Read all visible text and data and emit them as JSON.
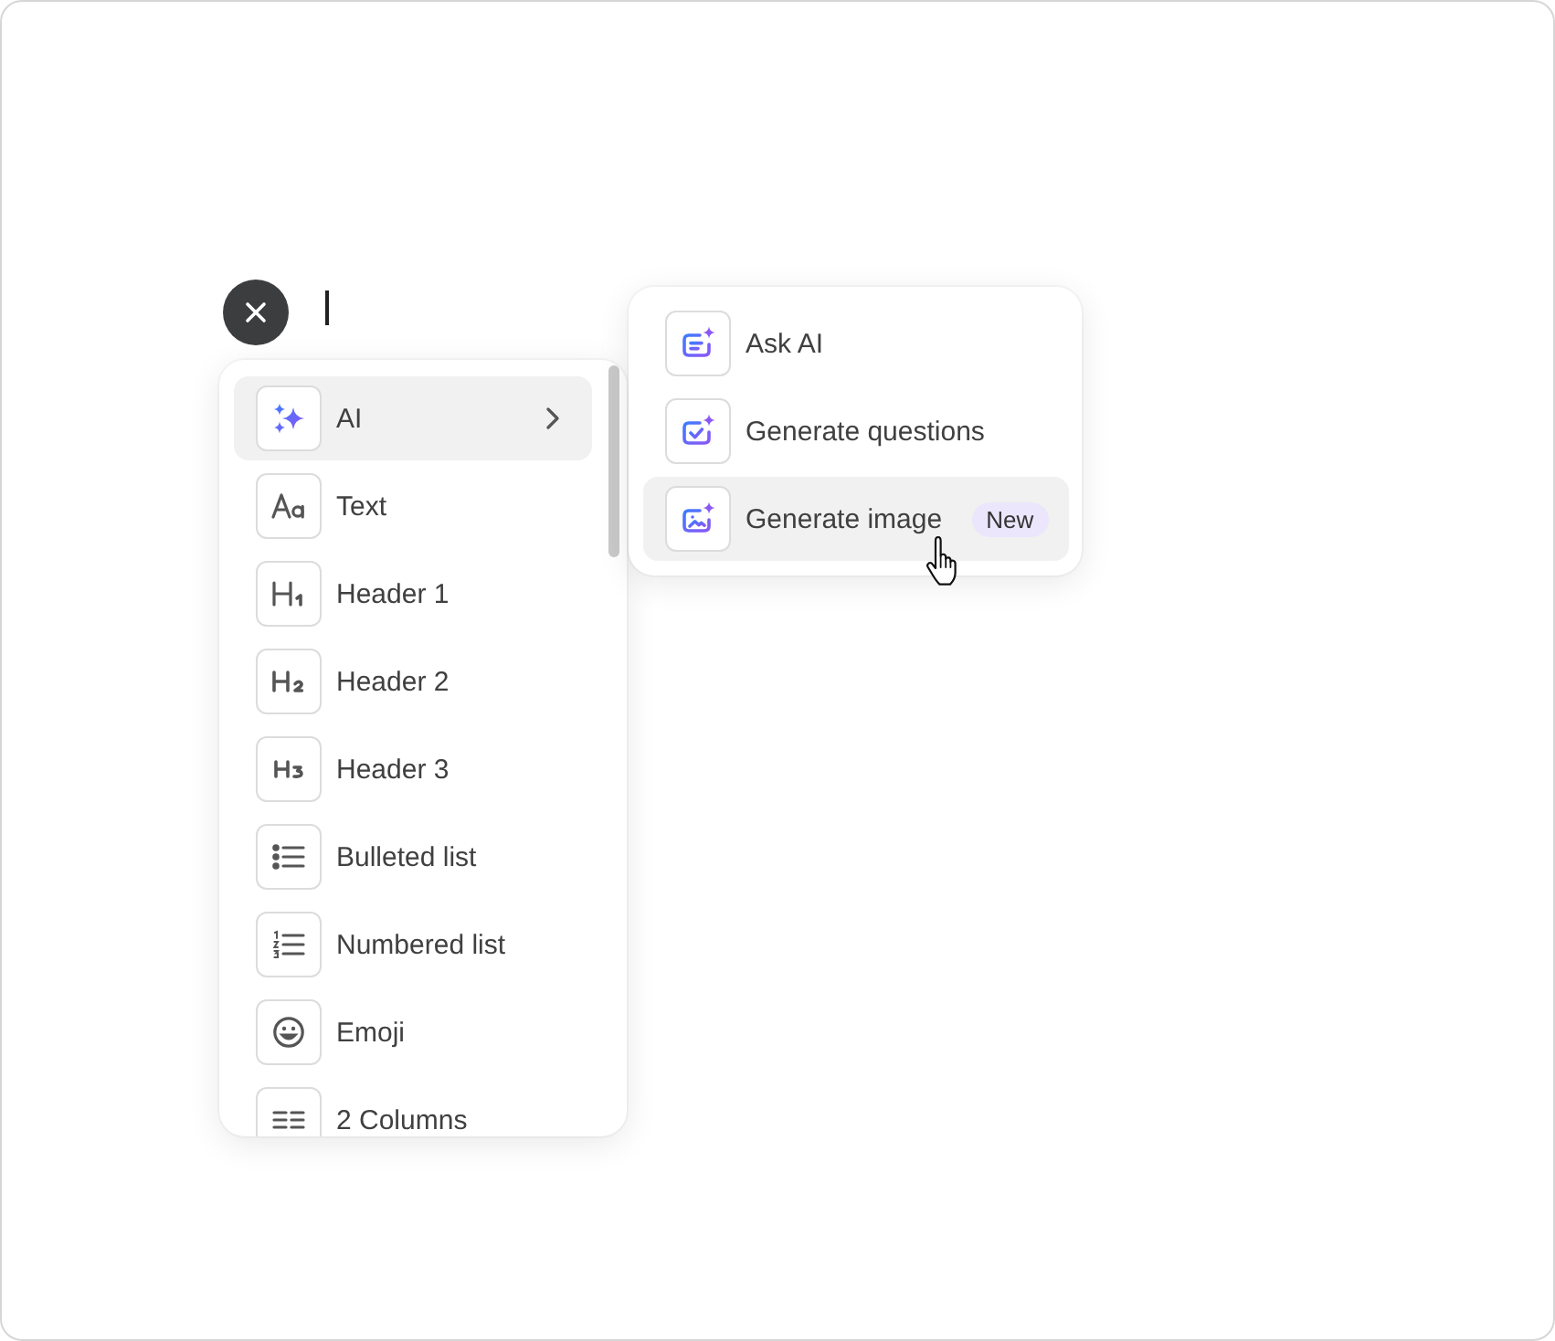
{
  "block_menu": {
    "items": [
      {
        "kind": "ai",
        "label": "AI",
        "submenu": true,
        "selected": true
      },
      {
        "kind": "text",
        "label": "Text",
        "submenu": false,
        "selected": false
      },
      {
        "kind": "heading1",
        "label": "Header 1",
        "submenu": false,
        "selected": false
      },
      {
        "kind": "heading2",
        "label": "Header 2",
        "submenu": false,
        "selected": false
      },
      {
        "kind": "heading3",
        "label": "Header 3",
        "submenu": false,
        "selected": false
      },
      {
        "kind": "bulleted",
        "label": "Bulleted list",
        "submenu": false,
        "selected": false
      },
      {
        "kind": "numbered",
        "label": "Numbered list",
        "submenu": false,
        "selected": false
      },
      {
        "kind": "emoji",
        "label": "Emoji",
        "submenu": false,
        "selected": false
      },
      {
        "kind": "columns",
        "label": "2 Columns",
        "submenu": false,
        "selected": false
      }
    ]
  },
  "ai_submenu": {
    "items": [
      {
        "kind": "ask",
        "label": "Ask AI",
        "selected": false
      },
      {
        "kind": "questions",
        "label": "Generate questions",
        "selected": false
      },
      {
        "kind": "image",
        "label": "Generate image",
        "badge": "New",
        "selected": true
      }
    ]
  }
}
